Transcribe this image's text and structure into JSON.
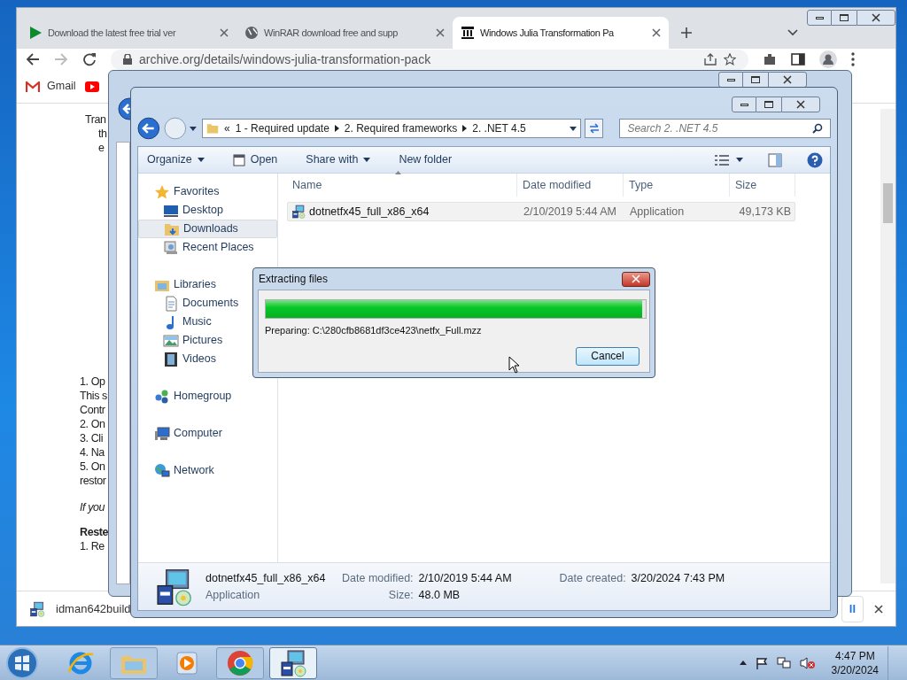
{
  "browser": {
    "tabs": [
      {
        "title": "Download the latest free trial ver",
        "kind": "play",
        "selected": false
      },
      {
        "title": "WinRAR download free and supp",
        "kind": "globe",
        "selected": false
      },
      {
        "title": "Windows Julia Transformation Pa",
        "kind": "archive",
        "selected": true
      }
    ],
    "address": "archive.org/details/windows-julia-transformation-pack",
    "bookmarks": [
      {
        "label": "Gmail",
        "kind": "gmail"
      },
      {
        "kind": "youtube"
      }
    ],
    "page": [
      {
        "kind": "centered",
        "lines": [
          "Tran",
          "th",
          "e"
        ]
      },
      {
        "kind": "plain",
        "lines": [
          "1. Op",
          "This s",
          "Contr",
          "2. On",
          "3. Cli",
          "4. Na",
          "5. On",
          "restor"
        ]
      },
      {
        "kind": "italic",
        "lines": [
          "If you"
        ]
      },
      {
        "kind": "heading",
        "lines": [
          "Reste"
        ]
      },
      {
        "kind": "plain",
        "lines": [
          "1. Re"
        ]
      }
    ],
    "download": {
      "file": "idman642build",
      "button": "ll"
    }
  },
  "explorer": {
    "breadcrumb_overflow": "«",
    "breadcrumb": [
      "1 - Required update",
      "2. Required frameworks",
      "2. .NET 4.5"
    ],
    "search_placeholder": "Search 2. .NET 4.5",
    "commands": [
      {
        "label": "Organize",
        "kind": "plain",
        "dropdown": true
      },
      {
        "label": "Open",
        "kind": "open",
        "dropdown": false
      },
      {
        "label": "Share with",
        "kind": "plain",
        "dropdown": true
      },
      {
        "label": "New folder",
        "kind": "plain",
        "dropdown": false
      }
    ],
    "nav": [
      {
        "label": "Favorites",
        "kind": "star",
        "children": [
          {
            "label": "Desktop",
            "kind": "desktop",
            "selected": false
          },
          {
            "label": "Downloads",
            "kind": "downloads",
            "selected": true
          },
          {
            "label": "Recent Places",
            "kind": "recent",
            "selected": false
          }
        ]
      },
      {
        "label": "Libraries",
        "kind": "libraries",
        "children": [
          {
            "label": "Documents",
            "kind": "document",
            "selected": false
          },
          {
            "label": "Music",
            "kind": "music",
            "selected": false
          },
          {
            "label": "Pictures",
            "kind": "pictures",
            "selected": false
          },
          {
            "label": "Videos",
            "kind": "videos",
            "selected": false
          }
        ]
      },
      {
        "label": "Homegroup",
        "kind": "homegroup"
      },
      {
        "label": "Computer",
        "kind": "computer"
      },
      {
        "label": "Network",
        "kind": "network"
      }
    ],
    "columns": [
      "Name",
      "Date modified",
      "Type",
      "Size"
    ],
    "rows": [
      {
        "name": "dotnetfx45_full_x86_x64",
        "date": "2/10/2019 5:44 AM",
        "type": "Application",
        "size": "49,173 KB"
      }
    ],
    "details": {
      "name": "dotnetfx45_full_x86_x64",
      "kind": "Application",
      "modified_label": "Date modified:",
      "modified": "2/10/2019 5:44 AM",
      "size_label": "Size:",
      "size": "48.0 MB",
      "created_label": "Date created:",
      "created": "3/20/2024 7:43 PM"
    }
  },
  "dialog": {
    "title": "Extracting files",
    "level": 0.99,
    "status": "Preparing: C:\\280cfb8681df3ce423\\netfx_Full.mzz",
    "button": "Cancel"
  },
  "taskbar": {
    "apps": [
      {
        "kind": "ie",
        "selected": false
      },
      {
        "kind": "explorer",
        "selected": false
      },
      {
        "kind": "media",
        "selected": false
      },
      {
        "kind": "chrome",
        "selected": false
      },
      {
        "kind": "installer",
        "selected": true
      }
    ],
    "time": "4:47 PM",
    "date": "3/20/2024"
  }
}
